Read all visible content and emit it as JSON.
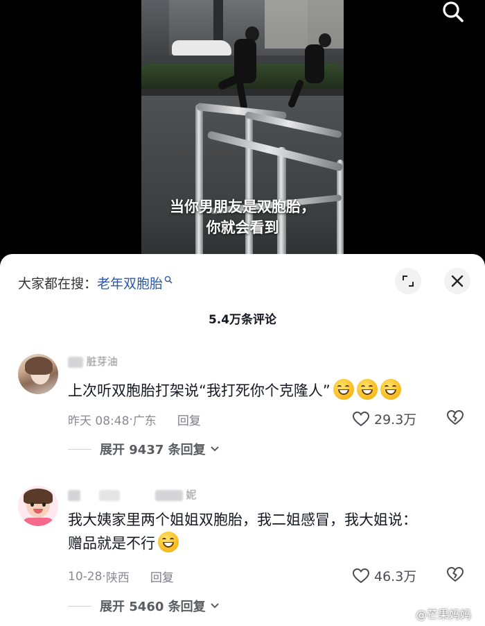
{
  "video": {
    "caption_line1": "当你男朋友是双胞胎，",
    "caption_line2": "你就会看到"
  },
  "top_bar": {
    "search_icon": "search-icon"
  },
  "sheet": {
    "hot_search_prefix": "大家都在搜：",
    "hot_search_link": "老年双胞胎",
    "comment_count": "5.4万条评论",
    "expand_icon": "expand-icon",
    "close_icon": "close-icon"
  },
  "comments": [
    {
      "username_visible": "脏芽油",
      "text": "上次听双胞胎打架说“我打死你个克隆人”",
      "emoji_count": 3,
      "time": "昨天 08:48",
      "location": "广东",
      "reply_label": "回复",
      "likes": "29.3万",
      "expand_label": "展开 9437 条回复"
    },
    {
      "username_visible": "妮",
      "text_line1": "我大姨家里两个姐姐双胞胎，我二姐感冒，我大姐说：",
      "text_line2": "赠品就是不行",
      "emoji_count": 1,
      "time": "10-28",
      "location": "陕西",
      "reply_label": "回复",
      "likes": "46.3万",
      "expand_label": "展开 5460 条回复"
    }
  ],
  "watermark": "@芒果妈妈",
  "colors": {
    "link": "#2b58a8",
    "sheet_bg": "#ffffff",
    "meta": "#8a8b91"
  }
}
